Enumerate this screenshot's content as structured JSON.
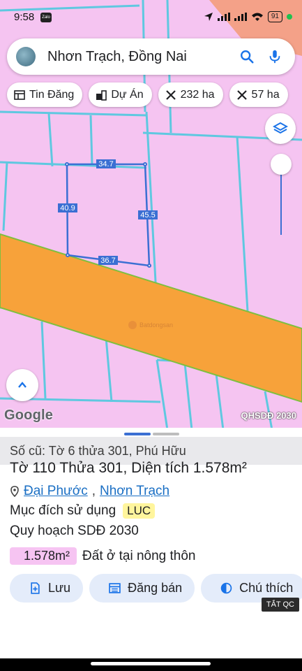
{
  "status_bar": {
    "time": "9:58",
    "app_badge": "Zalo",
    "battery": "91"
  },
  "search": {
    "query": "Nhơn Trạch, Đồng Nai",
    "search_icon": "search-icon",
    "mic_icon": "mic-icon"
  },
  "chips": [
    {
      "label": "Tin Đăng",
      "icon": "list-icon"
    },
    {
      "label": "Dự Án",
      "icon": "building-icon"
    },
    {
      "label": "232 ha",
      "icon": "cross-measure-icon"
    },
    {
      "label": "57 ha",
      "icon": "cross-measure-icon"
    }
  ],
  "map": {
    "parcel_dims": {
      "top": "34.7",
      "left": "40.9",
      "right": "45.5",
      "bottom": "36.7"
    },
    "watermark": "Batdongsan",
    "google_logo": "Google",
    "layer_label": "QHSDĐ 2030",
    "colors": {
      "land": "#f5c4f1",
      "road_band": "#f7a23a",
      "lot_lines": "#5fc8e0",
      "parcel": "#3b6fd3"
    }
  },
  "sheet": {
    "old_parcel": "Số cũ: Tờ 6 thửa 301, Phú Hữu",
    "lot_info": "Tờ 110 Thửa 301, Diện tích 1.578m²",
    "ward": "Đại Phước",
    "separator": ",",
    "district": "Nhơn Trạch",
    "purpose_label": "Mục đích sử dụng",
    "purpose_code": "LUC",
    "plan_label": "Quy hoạch SDĐ 2030",
    "plan_area": "1.578m²",
    "plan_use": "Đất ở tại nông thôn",
    "actions": [
      {
        "label": "Lưu",
        "icon": "add-doc-icon"
      },
      {
        "label": "Đăng bán",
        "icon": "listing-icon"
      },
      {
        "label": "Chú thích",
        "icon": "contrast-icon"
      }
    ],
    "tat_qc": "TẮT QC"
  }
}
